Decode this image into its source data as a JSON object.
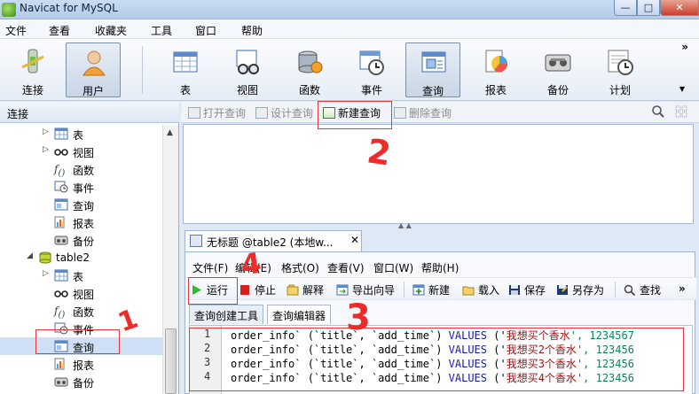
{
  "window": {
    "title": "Navicat for MySQL",
    "min": "—",
    "max": "□",
    "close": "✕"
  },
  "menubar": [
    "文件",
    "查看",
    "收藏夹",
    "工具",
    "窗口",
    "帮助"
  ],
  "toolbar": {
    "items": [
      {
        "label": "连接",
        "icon": "connect-icon"
      },
      {
        "label": "用户",
        "icon": "user-icon",
        "active": true
      },
      {
        "label": "表",
        "icon": "table-icon"
      },
      {
        "label": "视图",
        "icon": "view-icon"
      },
      {
        "label": "函数",
        "icon": "function-icon"
      },
      {
        "label": "事件",
        "icon": "event-icon"
      },
      {
        "label": "查询",
        "icon": "query-icon",
        "active": true
      },
      {
        "label": "报表",
        "icon": "report-icon"
      },
      {
        "label": "备份",
        "icon": "backup-icon"
      },
      {
        "label": "计划",
        "icon": "schedule-icon"
      }
    ],
    "more": "»"
  },
  "left": {
    "header": "连接",
    "tree": [
      {
        "label": "表",
        "icon": "table-icon",
        "expand": "▷",
        "indent": 1
      },
      {
        "label": "视图",
        "icon": "view-icon",
        "expand": "▷",
        "indent": 1
      },
      {
        "label": "函数",
        "icon": "function-icon",
        "indent": 1
      },
      {
        "label": "事件",
        "icon": "event-icon",
        "indent": 1
      },
      {
        "label": "查询",
        "icon": "query-icon",
        "indent": 1
      },
      {
        "label": "报表",
        "icon": "report-icon",
        "indent": 1
      },
      {
        "label": "备份",
        "icon": "backup-icon",
        "indent": 1
      },
      {
        "label": "table2",
        "icon": "database-icon",
        "expand": "◢",
        "indent": 0
      },
      {
        "label": "表",
        "icon": "table-icon",
        "expand": "▷",
        "indent": 1
      },
      {
        "label": "视图",
        "icon": "view-icon",
        "indent": 1
      },
      {
        "label": "函数",
        "icon": "function-icon",
        "indent": 1
      },
      {
        "label": "事件",
        "icon": "event-icon",
        "indent": 1
      },
      {
        "label": "查询",
        "icon": "query-icon",
        "indent": 1,
        "selected": true
      },
      {
        "label": "报表",
        "icon": "report-icon",
        "indent": 1
      },
      {
        "label": "备份",
        "icon": "backup-icon",
        "indent": 1
      }
    ]
  },
  "objtoolbar": {
    "open": "打开查询",
    "design": "设计查询",
    "new": "新建查询",
    "delete": "删除查询"
  },
  "doc": {
    "tab": "无标题 @table2 (本地w...",
    "close": "✕",
    "menu": [
      "文件(F)",
      "编辑(E)",
      "格式(O)",
      "查看(V)",
      "窗口(W)",
      "帮助(H)"
    ],
    "tools": {
      "run": "运行",
      "stop": "停止",
      "explain": "解释",
      "export": "导出向导",
      "new": "新建",
      "load": "载入",
      "save": "保存",
      "saveas": "另存为",
      "find": "查找",
      "more": "»"
    },
    "tabs": [
      "查询创建工具",
      "查询编辑器"
    ],
    "code": [
      {
        "n": "1",
        "table": "order_info`",
        "cols": " (`title`, `add_time`) ",
        "kw": "VALUES",
        "open": " ('",
        "str": "我想买个香水",
        "rest": "', 1234567"
      },
      {
        "n": "2",
        "table": "order_info`",
        "cols": " (`title`, `add_time`) ",
        "kw": "VALUES",
        "open": " ('",
        "str": "我想买2个香水",
        "rest": "', 123456"
      },
      {
        "n": "3",
        "table": "order_info`",
        "cols": " (`title`, `add_time`) ",
        "kw": "VALUES",
        "open": " ('",
        "str": "我想买3个香水",
        "rest": "', 123456"
      },
      {
        "n": "4",
        "table": "order_info`",
        "cols": " (`title`, `add_time`) ",
        "kw": "VALUES",
        "open": " ('",
        "str": "我想买4个香水",
        "rest": "', 123456"
      }
    ]
  },
  "annotations": [
    "1",
    "2",
    "3",
    "4"
  ],
  "colors": {
    "annotation": "#e23a3a",
    "keyword": "#1a1aa6",
    "string": "#a31515",
    "number": "#098658"
  }
}
